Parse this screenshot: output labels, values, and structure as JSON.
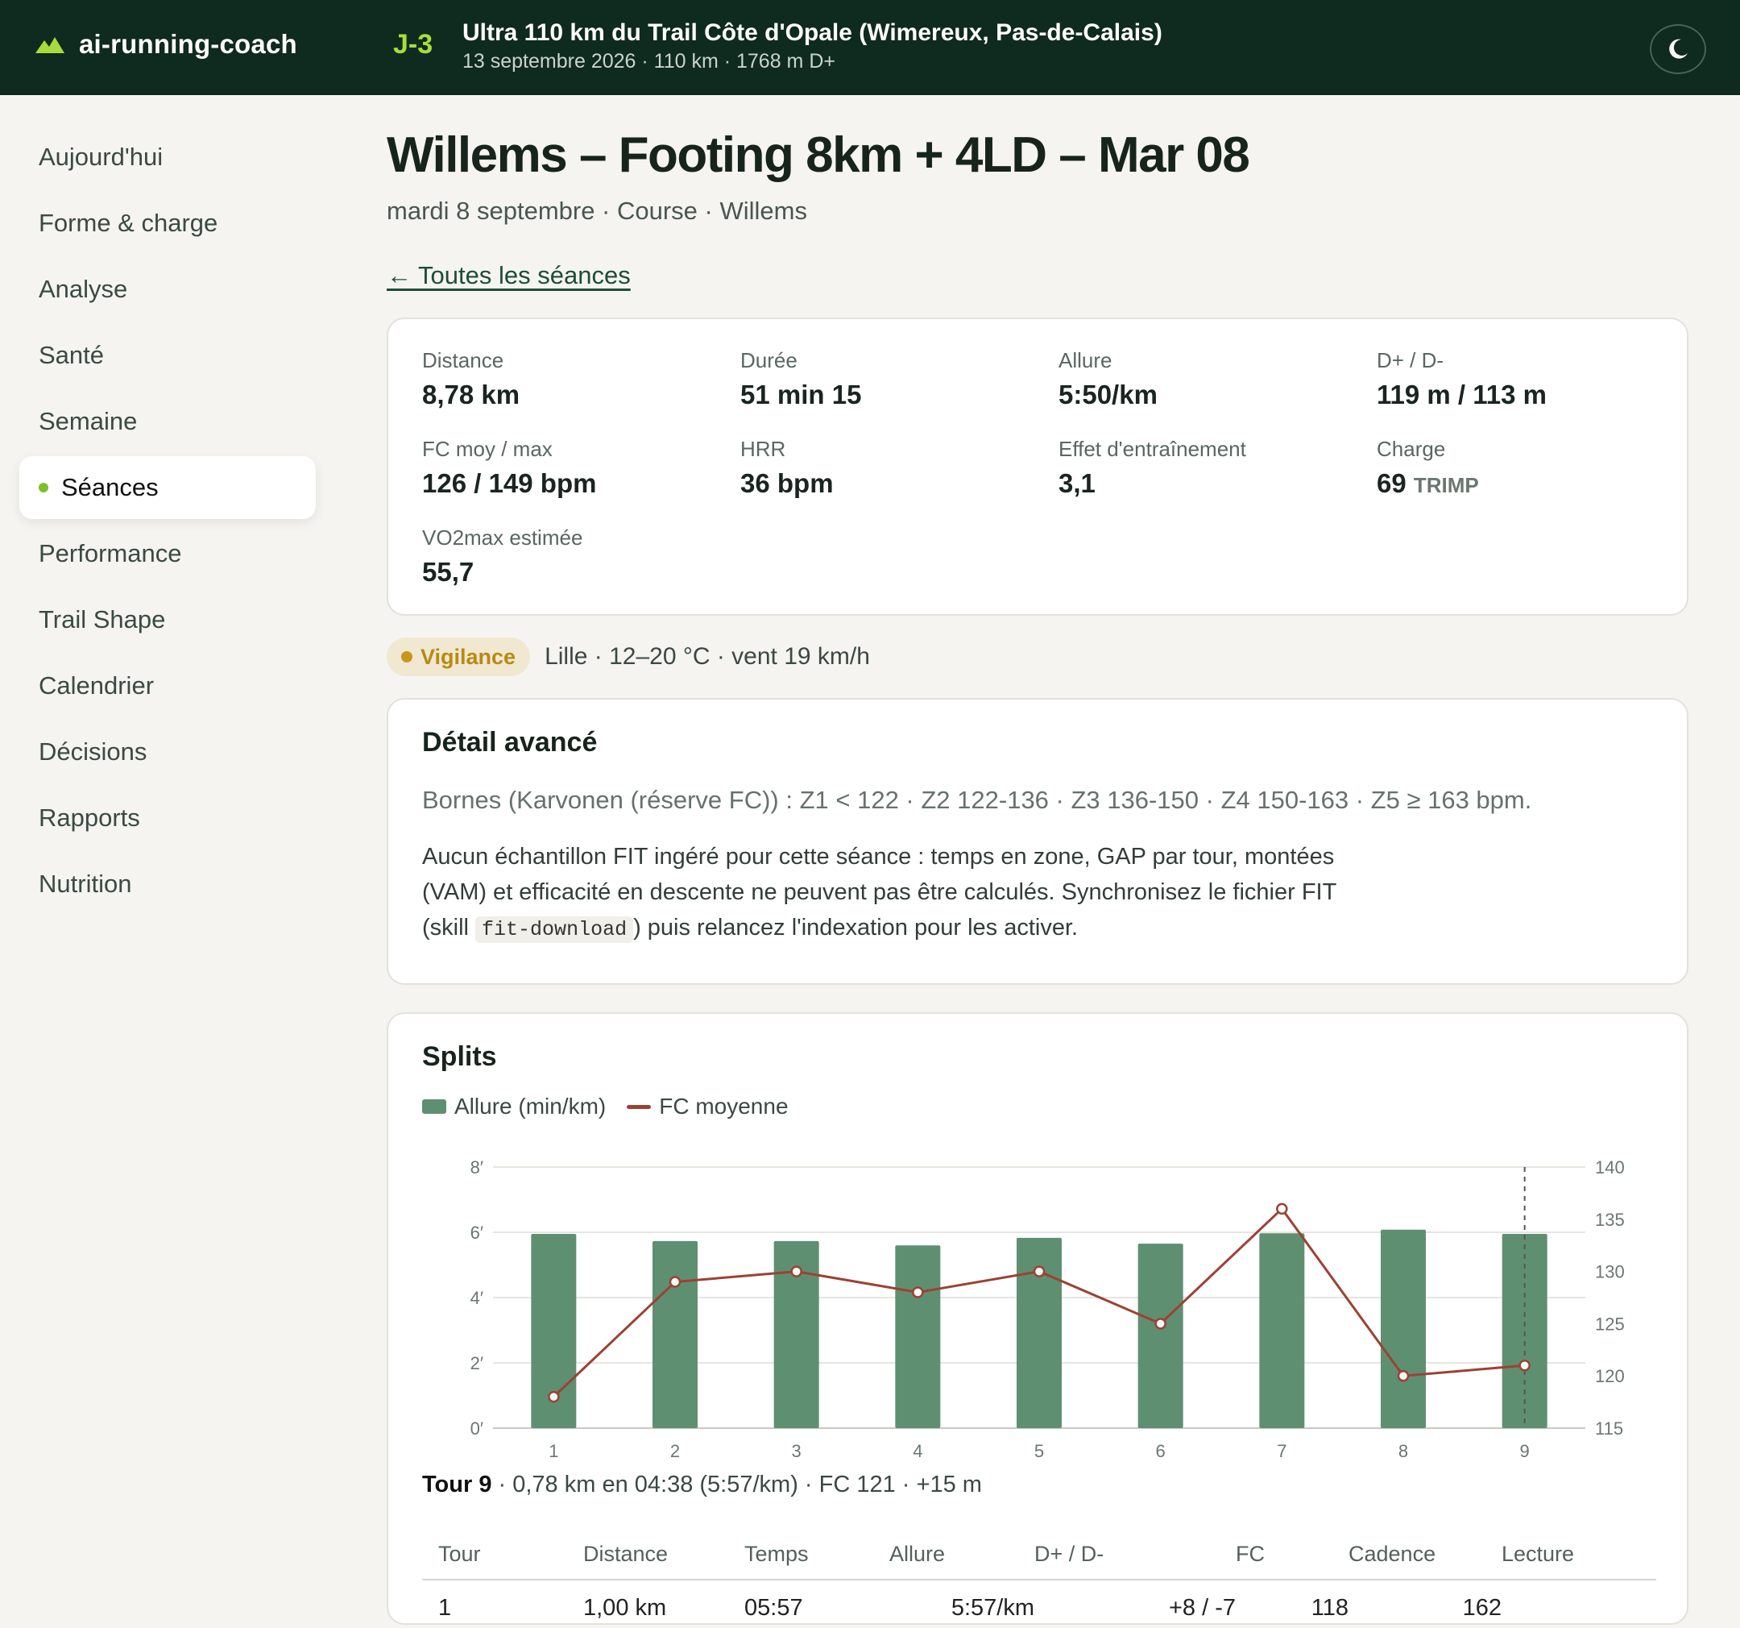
{
  "app": {
    "name": "ai-running-coach",
    "brand_color": "#0f2a1f",
    "accent_color": "#a6dd3d"
  },
  "race": {
    "countdown": "J-3",
    "title": "Ultra 110 km du Trail Côte d'Opale (Wimereux, Pas-de-Calais)",
    "meta": "13 septembre 2026 · 110 km · 1768 m D+"
  },
  "header_icons": {
    "brand": "mountain-icon",
    "theme": "moon-icon"
  },
  "nav": {
    "items": [
      {
        "label": "Aujourd'hui"
      },
      {
        "label": "Forme & charge"
      },
      {
        "label": "Analyse"
      },
      {
        "label": "Santé"
      },
      {
        "label": "Semaine"
      },
      {
        "label": "Séances",
        "active": true
      },
      {
        "label": "Performance"
      },
      {
        "label": "Trail Shape"
      },
      {
        "label": "Calendrier"
      },
      {
        "label": "Décisions"
      },
      {
        "label": "Rapports"
      },
      {
        "label": "Nutrition"
      }
    ]
  },
  "page": {
    "title": "Willems – Footing 8km + 4LD – Mar 08",
    "subtitle": "mardi 8 septembre · Course · Willems",
    "back_link": "← Toutes les séances"
  },
  "stats": {
    "distance": {
      "label": "Distance",
      "value": "8,78 km"
    },
    "duration": {
      "label": "Durée",
      "value": "51 min 15"
    },
    "pace": {
      "label": "Allure",
      "value": "5:50/km"
    },
    "elevation": {
      "label": "D+ / D-",
      "value": "119 m / 113 m"
    },
    "hr": {
      "label": "FC moy / max",
      "value": "126 / 149 bpm"
    },
    "hrr": {
      "label": "HRR",
      "value": "36 bpm"
    },
    "training_effect": {
      "label": "Effet d'entraînement",
      "value": "3,1"
    },
    "load": {
      "label": "Charge",
      "value": "69",
      "unit": "TRIMP"
    },
    "vo2max": {
      "label": "VO2max estimée",
      "value": "55,7"
    }
  },
  "weather": {
    "badge": "Vigilance",
    "badge_color": "#b88a12",
    "text": "Lille · 12–20 °C · vent 19 km/h"
  },
  "detail": {
    "title": "Détail avancé",
    "zones": "Bornes (Karvonen (réserve FC)) : Z1 < 122 · Z2 122-136 · Z3 136-150 · Z4 150-163 · Z5 ≥ 163 bpm.",
    "text_before": "Aucun échantillon FIT ingéré pour cette séance : temps en zone, GAP par tour, montées (VAM) et efficacité en descente ne peuvent pas être calculés. Synchronisez le fichier FIT (skill ",
    "code": "fit-download",
    "text_after": ") puis relancez l'indexation pour les activer."
  },
  "splits": {
    "title": "Splits",
    "legend_pace": "Allure (min/km)",
    "legend_hr": "FC moyenne",
    "selected_tour_label": "Tour 9",
    "selected_tour_detail": " · 0,78 km en 04:38 (5:57/km) · FC 121 · +15 m",
    "table_headers": [
      "Tour",
      "Distance",
      "Temps",
      "Allure",
      "D+ / D-",
      "FC",
      "Cadence",
      "Lecture"
    ],
    "table_rows": [
      [
        "1",
        "1,00 km",
        "05:57",
        "5:57/km",
        "+8 / -7",
        "118",
        "162",
        ""
      ]
    ]
  },
  "chart_data": {
    "type": "bar",
    "categories": [
      "1",
      "2",
      "3",
      "4",
      "5",
      "6",
      "7",
      "8",
      "9"
    ],
    "series": [
      {
        "name": "Allure (min/km)",
        "type": "bar",
        "axis": "left",
        "values": [
          5.95,
          5.73,
          5.73,
          5.6,
          5.83,
          5.65,
          5.97,
          6.08,
          5.95
        ],
        "color": "#5f8f71"
      },
      {
        "name": "FC moyenne",
        "type": "line",
        "axis": "right",
        "values": [
          118,
          129,
          130,
          128,
          130,
          125,
          136,
          120,
          121
        ],
        "color": "#9b4233"
      }
    ],
    "y_left": {
      "ticks": [
        "0′",
        "2′",
        "4′",
        "6′",
        "8′"
      ],
      "range": [
        0,
        8
      ]
    },
    "y_right": {
      "ticks": [
        "115",
        "120",
        "125",
        "130",
        "135",
        "140"
      ],
      "range": [
        115,
        140
      ]
    },
    "highlight_category": "9",
    "grid": true
  }
}
